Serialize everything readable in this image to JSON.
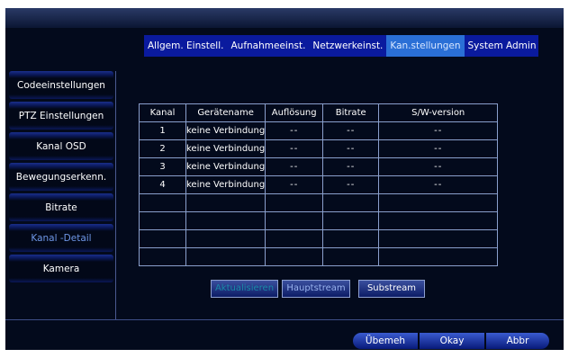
{
  "tabs": [
    {
      "label": "Allgem. Einstell.",
      "active": false
    },
    {
      "label": "Aufnahmeeinst.",
      "active": false
    },
    {
      "label": "Netzwerkeinst.",
      "active": false
    },
    {
      "label": "Kan.stellungen",
      "active": true
    },
    {
      "label": "System Admin",
      "active": false
    }
  ],
  "sidebar": {
    "items": [
      {
        "label": "Codeeinstellungen"
      },
      {
        "label": "PTZ Einstellungen"
      },
      {
        "label": "Kanal OSD"
      },
      {
        "label": "Bewegungserkenn."
      },
      {
        "label": "Bitrate"
      },
      {
        "label": "Kanal -Detail"
      },
      {
        "label": "Kamera"
      }
    ],
    "active_index": 5
  },
  "table": {
    "headers": [
      "Kanal",
      "Gerätename",
      "Auflösung",
      "Bitrate",
      "S/W-version"
    ],
    "rows": [
      [
        "1",
        "keine Verbindung",
        "--",
        "--",
        "--"
      ],
      [
        "2",
        "keine Verbindung",
        "--",
        "--",
        "--"
      ],
      [
        "3",
        "keine Verbindung",
        "--",
        "--",
        "--"
      ],
      [
        "4",
        "keine Verbindung",
        "--",
        "--",
        "--"
      ],
      [
        "",
        "",
        "",
        "",
        ""
      ],
      [
        "",
        "",
        "",
        "",
        ""
      ],
      [
        "",
        "",
        "",
        "",
        ""
      ],
      [
        "",
        "",
        "",
        "",
        ""
      ]
    ]
  },
  "buttons": {
    "refresh": "Aktualisieren",
    "mainstream": "Hauptstream",
    "substream": "Substream"
  },
  "footer": {
    "apply": "Übemeh",
    "ok": "Okay",
    "cancel": "Abbr"
  },
  "colors": {
    "background": "#030a1c",
    "tabbar": "#0a1a9e",
    "active_tab": "#2a6fd6",
    "grid_line": "#8a9fcc"
  }
}
